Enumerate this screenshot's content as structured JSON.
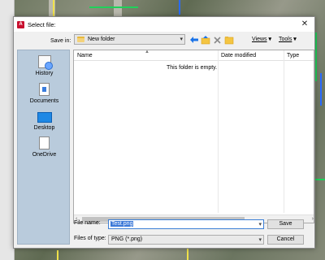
{
  "dialog": {
    "title": "Select file:",
    "app_icon_letter": "A",
    "close_symbol": "✕"
  },
  "toolbar": {
    "save_in_label": "Save in:",
    "save_in_value": "New folder",
    "views_label": "Views",
    "tools_label": "Tools",
    "dropdown_symbol": "▾"
  },
  "places": [
    {
      "label": "History",
      "icon": "history-icon"
    },
    {
      "label": "Documents",
      "icon": "documents-icon"
    },
    {
      "label": "Desktop",
      "icon": "desktop-icon"
    },
    {
      "label": "OneDrive",
      "icon": "onedrive-icon"
    }
  ],
  "file_list": {
    "columns": [
      "Name",
      "Date modified",
      "Type"
    ],
    "empty_message": "This folder is empty."
  },
  "form": {
    "file_name_label": "File name:",
    "file_name_value": "Test.png",
    "file_type_label": "Files of type:",
    "file_type_value": "PNG (*.png)",
    "save_label": "Save",
    "cancel_label": "Cancel"
  },
  "colors": {
    "accent": "#1a73e8",
    "places_bg": "#b9cbdc",
    "app_icon": "#c8102e"
  }
}
